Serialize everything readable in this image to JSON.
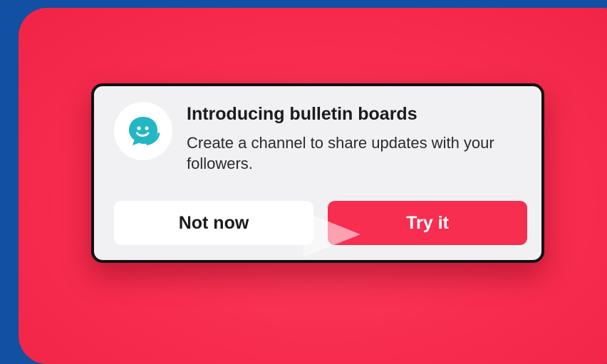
{
  "dialog": {
    "icon": "chat-bubbles-icon",
    "title": "Introducing bulletin boards",
    "body": "Create a channel to share updates with your followers.",
    "secondary_button_label": "Not now",
    "primary_button_label": "Try it"
  },
  "colors": {
    "page_background": "#1150a3",
    "backdrop": "#f72c4e",
    "dialog_background": "#f1f1f3",
    "primary_button": "#f72e50",
    "icon_accent": "#23b6c4"
  },
  "overlay_icon": "play-icon"
}
